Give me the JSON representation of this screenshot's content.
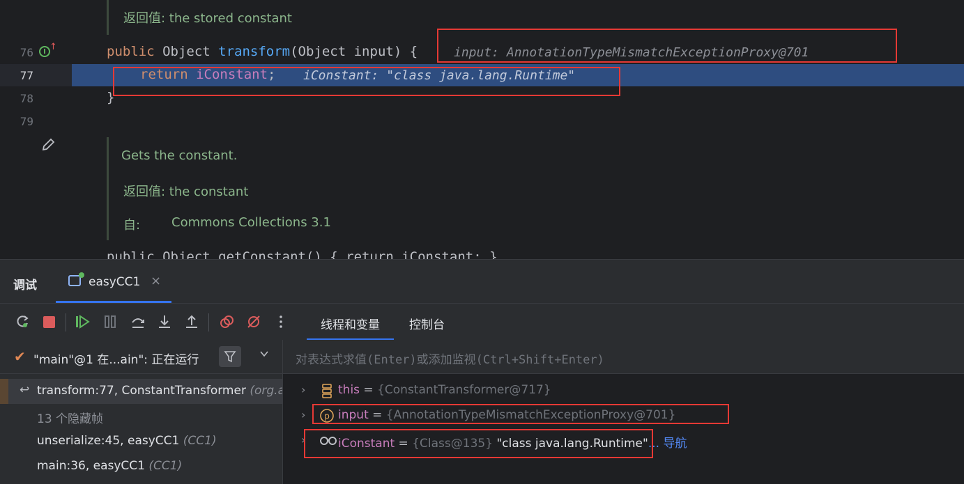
{
  "editor": {
    "doc_top": {
      "label": "返回值:",
      "text": " the stored constant"
    },
    "lines": [
      {
        "num": "76",
        "kw": "public",
        "type": " Object ",
        "fn": "transform",
        "params": "(Object input) {",
        "hint": "input: AnnotationTypeMismatchExceptionProxy@701"
      },
      {
        "num": "77",
        "kw": "return",
        "field": "iConstant",
        "semi": ";",
        "hint": "iConstant: \"class java.lang.Runtime\""
      },
      {
        "num": "78",
        "brace": "}"
      },
      {
        "num": "79"
      }
    ],
    "doc2": {
      "line1": "Gets the constant.",
      "line2_label": "返回值:",
      "line2_text": " the constant",
      "line3_label": "自:",
      "line3_text": "Commons Collections 3.1"
    },
    "cut_line": "public Object getConstant() { return iConstant; }"
  },
  "debug": {
    "panel_title": "调试",
    "config_tab": "easyCC1",
    "close": "×",
    "subtabs": [
      "线程和变量",
      "控制台"
    ],
    "thread": "\"main\"@1 在...ain\": 正在运行",
    "frames": [
      {
        "text": "transform:77, ConstantTransformer ",
        "pkg": "(org.a",
        "selected": true
      },
      {
        "text": "13 个隐藏帧",
        "pkg": "",
        "muted": true
      },
      {
        "text": "unserialize:45, easyCC1 ",
        "pkg": "(CC1)"
      },
      {
        "text": "main:36, easyCC1 ",
        "pkg": "(CC1)"
      }
    ],
    "eval_placeholder": "对表达式求值(Enter)或添加监视(Ctrl+Shift+Enter)",
    "variables": [
      {
        "name": "this",
        "eq": " = ",
        "value": "{ConstantTransformer@717}",
        "str": "",
        "link": ""
      },
      {
        "name": "input",
        "eq": " = ",
        "value": "{AnnotationTypeMismatchExceptionProxy@701}",
        "str": "",
        "link": ""
      },
      {
        "name": "iConstant",
        "eq": " = ",
        "value": "{Class@135} ",
        "str": "\"class java.lang.Runtime\"",
        "link": "... 导航"
      }
    ]
  },
  "colors": {
    "accent": "#3574f0",
    "highlight": "#2e4d80",
    "annotation": "#e53935"
  }
}
